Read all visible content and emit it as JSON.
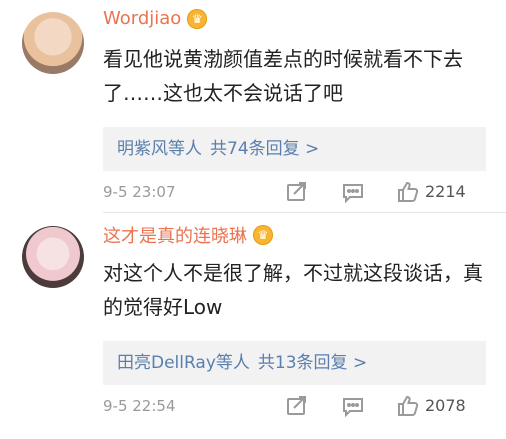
{
  "comments": [
    {
      "username": "Wordjiao",
      "badge_icon": "crown-icon",
      "text": "看见他说黄渤颜值差点的时候就看不下去了……这也太不会说话了吧",
      "replies_who": "明紫风等人",
      "replies_count": "共74条回复 >",
      "time": "9-5 23:07",
      "likes": "2214"
    },
    {
      "username": "这才是真的连晓琳",
      "badge_icon": "crown-icon",
      "text": "对这个人不是很了解，不过就这段谈话，真的觉得好Low",
      "replies_who": "田亮DellRay等人",
      "replies_count": "共13条回复 >",
      "time": "9-5 22:54",
      "likes": "2078"
    }
  ],
  "colors": {
    "username": "#eb7350",
    "link": "#5a7fae",
    "meta": "#9a9a9a",
    "reply_bg": "#f2f2f2"
  }
}
